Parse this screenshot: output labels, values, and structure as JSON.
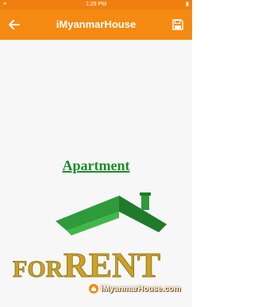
{
  "status_bar": {
    "left_text": "≡ ",
    "time": "1:29 PM",
    "right_text": "▮"
  },
  "app_bar": {
    "title": "iMyanmarHouse",
    "back_icon": "arrow-left-icon",
    "save_icon": "floppy-disk-icon"
  },
  "banner": {
    "heading": "Apartment",
    "for_text": "FOR",
    "rent_text": "RENT",
    "brand": "iMyanmarHouse.com"
  },
  "colors": {
    "primary": "#f58a12",
    "roof_green": "#2e9a3a",
    "gold": "#c9a227"
  }
}
